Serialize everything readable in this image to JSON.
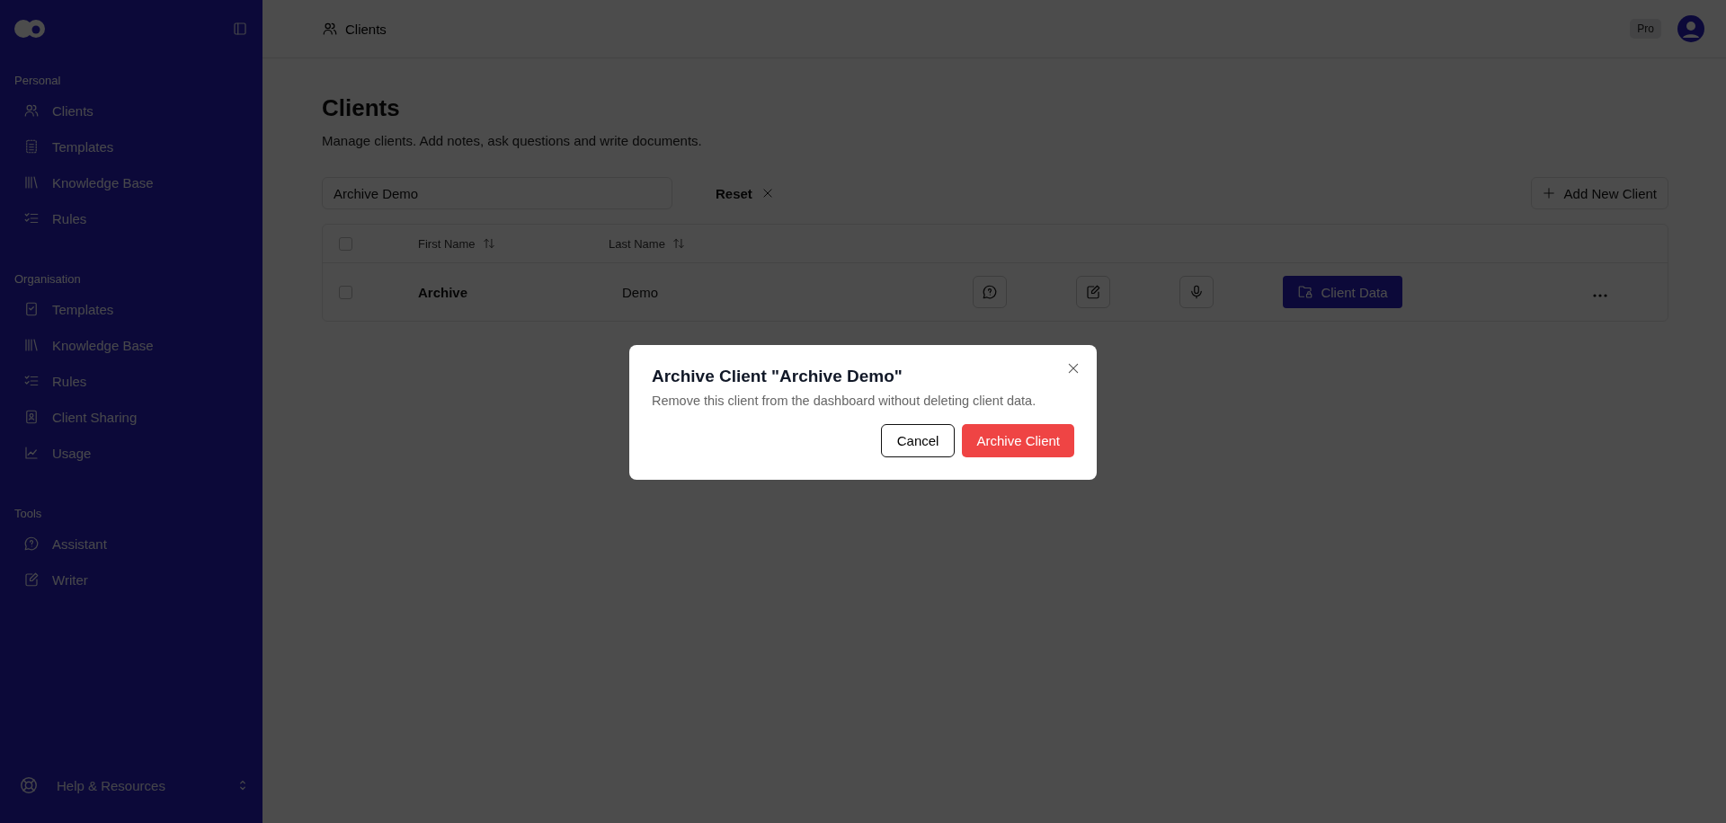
{
  "sidebar": {
    "sections": [
      {
        "label": "Personal",
        "items": [
          {
            "label": "Clients"
          },
          {
            "label": "Templates"
          },
          {
            "label": "Knowledge Base"
          },
          {
            "label": "Rules"
          }
        ]
      },
      {
        "label": "Organisation",
        "items": [
          {
            "label": "Templates"
          },
          {
            "label": "Knowledge Base"
          },
          {
            "label": "Rules"
          },
          {
            "label": "Client Sharing"
          },
          {
            "label": "Usage"
          }
        ]
      },
      {
        "label": "Tools",
        "items": [
          {
            "label": "Assistant"
          },
          {
            "label": "Writer"
          }
        ]
      }
    ],
    "help": {
      "label": "Help & Resources"
    }
  },
  "topbar": {
    "breadcrumb": "Clients",
    "plan_badge": "Pro"
  },
  "page": {
    "title": "Clients",
    "subtitle": "Manage clients. Add notes, ask questions and write documents.",
    "search": {
      "value": "Archive Demo"
    },
    "reset_button": "Reset",
    "add_button": "Add New Client"
  },
  "table": {
    "select_all": {
      "checked": false
    },
    "columns": [
      {
        "label": "First Name"
      },
      {
        "label": "Last Name"
      }
    ],
    "rows": [
      {
        "checked": false,
        "first_name": "Archive",
        "last_name": "Demo",
        "data_button": "Client Data"
      }
    ]
  },
  "dialog": {
    "title": "Archive Client \"Archive Demo\"",
    "message": "Remove this client from the dashboard without deleting client data.",
    "cancel": "Cancel",
    "confirm": "Archive Client"
  }
}
